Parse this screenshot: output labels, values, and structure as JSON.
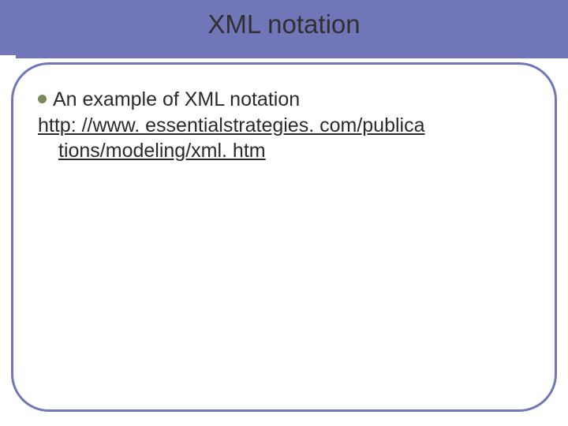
{
  "slide": {
    "title": "XML notation",
    "bullet_text": "An example of XML notation",
    "link_line1": "http: //www. essentialstrategies. com/publica",
    "link_line2": "tions/modeling/xml. htm"
  }
}
